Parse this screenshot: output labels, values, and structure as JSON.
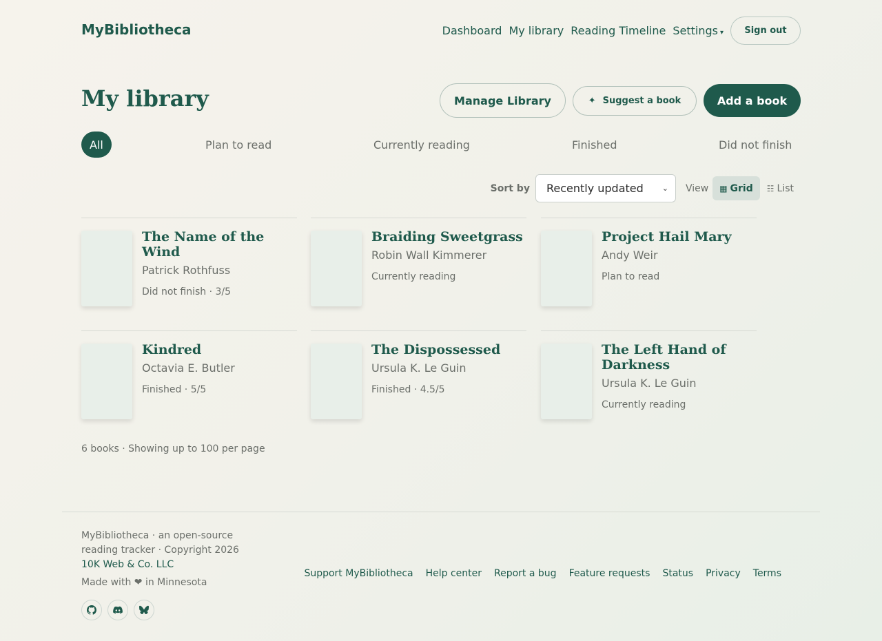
{
  "header": {
    "brand": "MyBibliotheca",
    "nav": [
      "Dashboard",
      "My library",
      "Reading Timeline",
      "Settings"
    ],
    "sign_out": "Sign out"
  },
  "page": {
    "title": "My library",
    "manage_label": "Manage Library",
    "suggest_label": "Suggest a book",
    "add_label": "Add a book"
  },
  "filters": [
    "All",
    "Plan to read",
    "Currently reading",
    "Finished",
    "Did not finish"
  ],
  "sort": {
    "label": "Sort by",
    "selected": "Recently updated"
  },
  "view": {
    "label": "View",
    "grid": "Grid",
    "list": "List",
    "active": "Grid"
  },
  "books": [
    {
      "title": "The Name of the Wind",
      "author": "Patrick Rothfuss",
      "status": "Did not finish · 3/5"
    },
    {
      "title": "Braiding Sweetgrass",
      "author": "Robin Wall Kimmerer",
      "status": "Currently reading"
    },
    {
      "title": "Project Hail Mary",
      "author": "Andy Weir",
      "status": "Plan to read"
    },
    {
      "title": "Kindred",
      "author": "Octavia E. Butler",
      "status": "Finished · 5/5"
    },
    {
      "title": "The Dispossessed",
      "author": "Ursula K. Le Guin",
      "status": "Finished · 4.5/5"
    },
    {
      "title": "The Left Hand of Darkness",
      "author": "Ursula K. Le Guin",
      "status": "Currently reading"
    }
  ],
  "summary": "6 books · Showing up to 100 per page",
  "footer": {
    "description": "MyBibliotheca · an open-source reading tracker · Copyright 2026",
    "company": "10K Web & Co. LLC",
    "made_with": "Made with ❤ in Minnesota",
    "socials": [
      "github-icon",
      "discord-icon",
      "bluesky-icon"
    ],
    "links": [
      "Support MyBibliotheca",
      "Help center",
      "Report a bug",
      "Feature requests",
      "Status",
      "Privacy",
      "Terms"
    ]
  },
  "colors": {
    "accent": "#1f5a4c",
    "muted": "#6b6f6a",
    "cover": "#e8efe9"
  }
}
